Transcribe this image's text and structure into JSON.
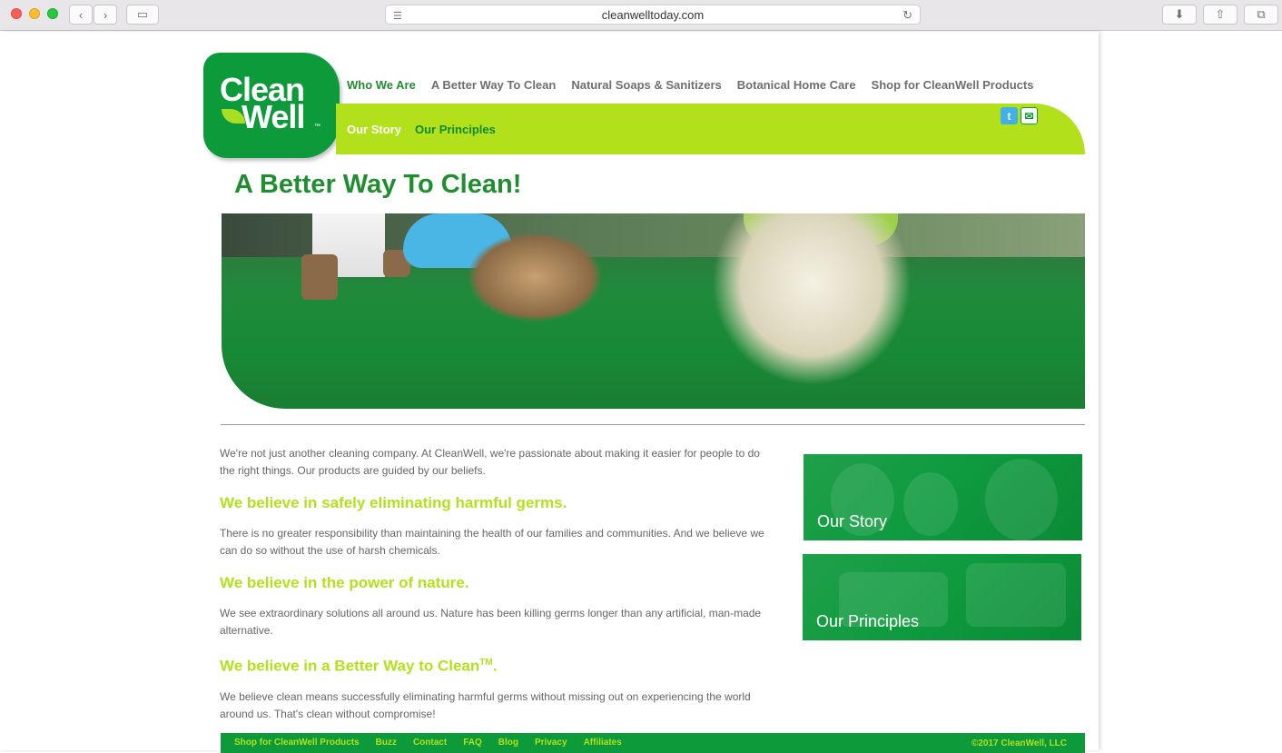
{
  "browser": {
    "url": "cleanwelltoday.com"
  },
  "logo": {
    "line1": "Clean",
    "line2": "Well",
    "tm": "™"
  },
  "topnav": [
    {
      "label": "Who We Are"
    },
    {
      "label": "A Better Way To Clean"
    },
    {
      "label": "Natural Soaps & Sanitizers"
    },
    {
      "label": "Botanical Home Care"
    },
    {
      "label": "Shop for CleanWell Products"
    }
  ],
  "subnav": [
    {
      "label": "Our Story"
    },
    {
      "label": "Our Principles"
    }
  ],
  "page": {
    "title": "A Better Way To Clean!"
  },
  "content": {
    "intro": "We're not just another cleaning company. At CleanWell, we're passionate about making it easier for people to do the right things. Our products are guided by our beliefs.",
    "h1": "We believe in safely eliminating harmful germs.",
    "p1": "There is no greater responsibility than maintaining the health of our families and communities. And we believe we can do so without the use of harsh chemicals.",
    "h2": "We believe in the power of nature.",
    "p2": "We see extraordinary solutions all around us. Nature has been killing germs longer than any artificial, man-made alternative.",
    "h3": "We believe in a Better Way to Clean",
    "h3_tm": "TM",
    "h3_end": ".",
    "p3": "We believe clean means successfully eliminating harmful germs without missing out on experiencing the world around us. That's clean without compromise!"
  },
  "panels": [
    {
      "label": "Our Story"
    },
    {
      "label": "Our Principles"
    }
  ],
  "footer": {
    "links": [
      {
        "label": "Shop for CleanWell Products"
      },
      {
        "label": "Buzz"
      },
      {
        "label": "Contact"
      },
      {
        "label": "FAQ"
      },
      {
        "label": "Blog"
      },
      {
        "label": "Privacy"
      },
      {
        "label": "Affiliates"
      }
    ],
    "copyright": "©2017 CleanWell, LLC"
  },
  "colors": {
    "brand_green": "#0d9a3a",
    "lime": "#b2e11c",
    "nav_active": "#1f8e2e"
  }
}
